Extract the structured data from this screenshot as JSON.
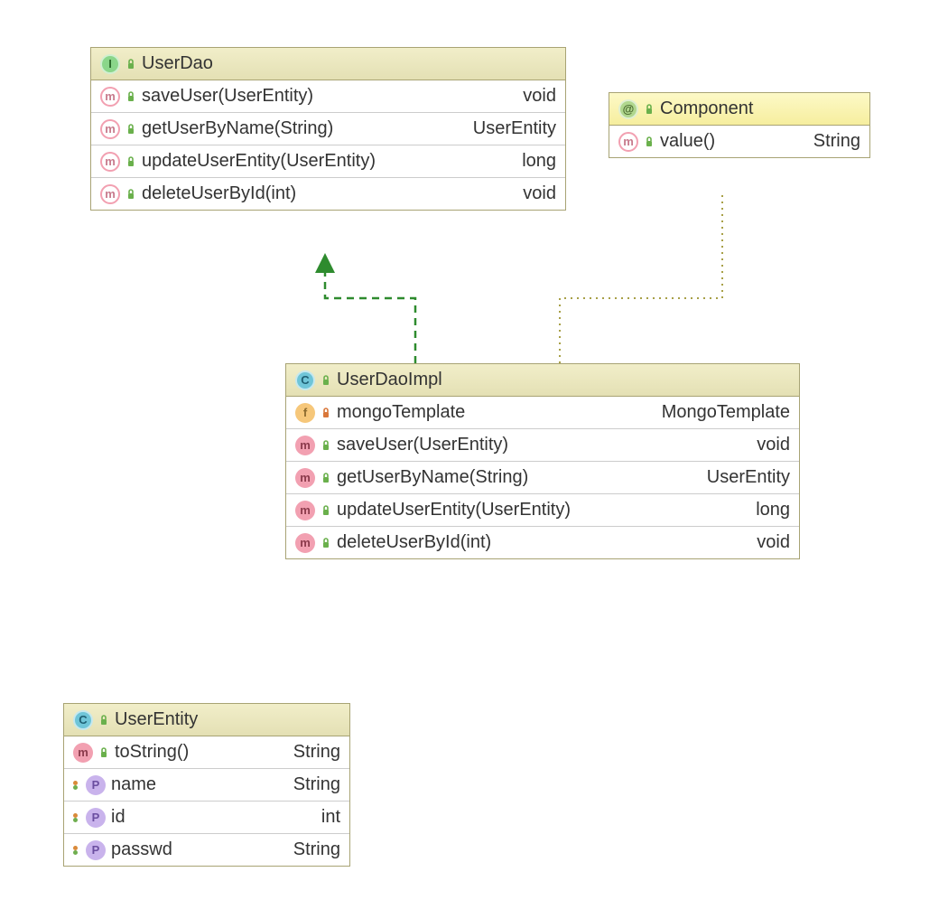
{
  "userDao": {
    "title": "UserDao",
    "kind": "interface",
    "methods": [
      {
        "sig": "saveUser(UserEntity)",
        "ret": "void"
      },
      {
        "sig": "getUserByName(String)",
        "ret": "UserEntity"
      },
      {
        "sig": "updateUserEntity(UserEntity)",
        "ret": "long"
      },
      {
        "sig": "deleteUserById(int)",
        "ret": "void"
      }
    ]
  },
  "component": {
    "title": "Component",
    "kind": "annotation",
    "methods": [
      {
        "sig": "value()",
        "ret": "String"
      }
    ]
  },
  "userDaoImpl": {
    "title": "UserDaoImpl",
    "kind": "class",
    "fields": [
      {
        "name": "mongoTemplate",
        "type": "MongoTemplate",
        "vis": "private",
        "kindIcon": "f"
      }
    ],
    "methods": [
      {
        "sig": "saveUser(UserEntity)",
        "ret": "void"
      },
      {
        "sig": "getUserByName(String)",
        "ret": "UserEntity"
      },
      {
        "sig": "updateUserEntity(UserEntity)",
        "ret": "long"
      },
      {
        "sig": "deleteUserById(int)",
        "ret": "void"
      }
    ]
  },
  "userEntity": {
    "title": "UserEntity",
    "kind": "class",
    "methods": [
      {
        "sig": "toString()",
        "ret": "String"
      }
    ],
    "props": [
      {
        "name": "name",
        "type": "String"
      },
      {
        "name": "id",
        "type": "int"
      },
      {
        "name": "passwd",
        "type": "String"
      }
    ]
  },
  "icons": {
    "interface_letter": "I",
    "class_letter": "C",
    "annotation_letter": "@",
    "method_letter": "m",
    "field_letter": "f",
    "prop_letter": "P"
  }
}
